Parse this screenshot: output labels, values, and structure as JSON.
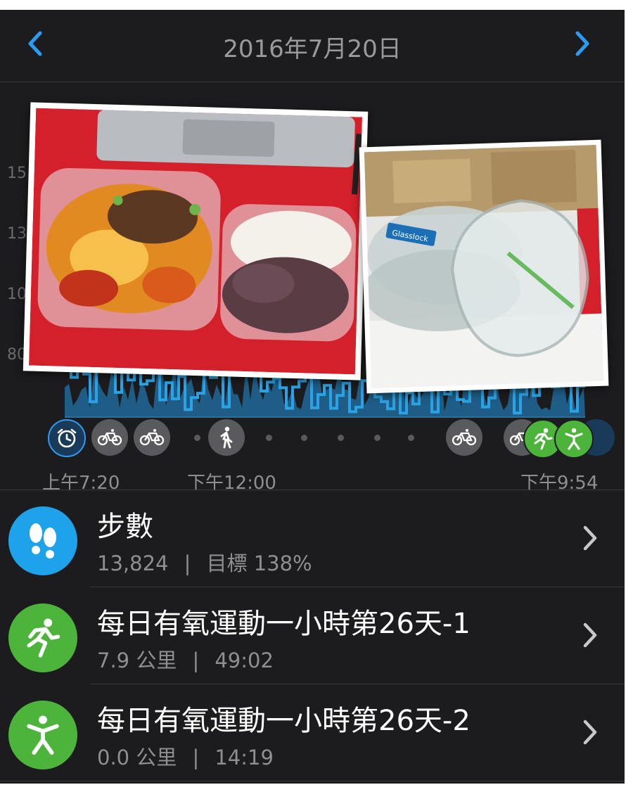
{
  "header": {
    "date": "2016年7月20日",
    "prev_icon": "chevron-left-icon",
    "next_icon": "chevron-right-icon",
    "accent": "#2b9cf2"
  },
  "chart": {
    "y_labels": [
      "15",
      "13",
      "10",
      "80"
    ],
    "time_labels": {
      "start": "上午7:20",
      "noon": "下午12:00",
      "end": "下午9:54"
    },
    "line_color": "#2aa3e6",
    "fill_color": "#1f5d86",
    "icons": [
      "alarm-clock-icon",
      "bicycle-icon",
      "bicycle-icon",
      "walking-icon",
      "bicycle-icon",
      "bicycle-icon",
      "running-icon",
      "activity-icon"
    ]
  },
  "rows": [
    {
      "icon": "footsteps-icon",
      "icon_color": "#1ea2ea",
      "title": "步數",
      "value1": "13,824",
      "value2": "目標 138%"
    },
    {
      "icon": "running-icon",
      "icon_color": "#4cb33b",
      "title": "每日有氧運動一小時第26天-1",
      "value1": "7.9 公里",
      "value2": "49:02"
    },
    {
      "icon": "activity-icon",
      "icon_color": "#4cb33b",
      "title": "每日有氧運動一小時第26天-2",
      "value1": "0.0 公里",
      "value2": "14:19"
    }
  ],
  "photos": {
    "left": "lunch box photo with vegetables and rice",
    "right": "glass food container photo",
    "brand_label": "Glasslock"
  }
}
